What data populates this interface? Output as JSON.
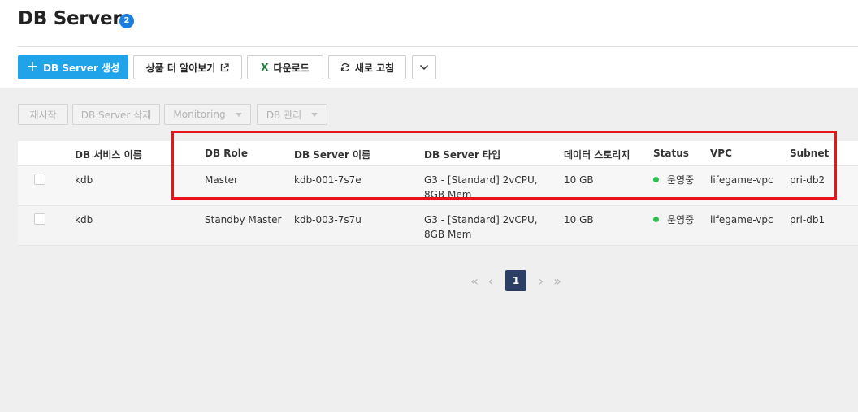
{
  "header": {
    "title": "DB Server",
    "count": "2"
  },
  "toolbar": {
    "create_label": "DB Server 생성",
    "learn_more_label": "상품 더 알아보기",
    "download_label": "다운로드",
    "refresh_label": "새로 고침"
  },
  "actions": {
    "restart_label": "재시작",
    "delete_label": "DB Server 삭제",
    "monitoring_label": "Monitoring",
    "db_manage_label": "DB 관리"
  },
  "table": {
    "columns": {
      "service_name": "DB 서비스 이름",
      "role": "DB Role",
      "server_name": "DB Server 이름",
      "server_type": "DB Server 타입",
      "storage": "데이터 스토리지",
      "status": "Status",
      "vpc": "VPC",
      "subnet": "Subnet"
    },
    "rows": [
      {
        "service_name": "kdb",
        "role": "Master",
        "server_name": "kdb-001-7s7e",
        "server_type": "G3 - [Standard] 2vCPU, 8GB Mem",
        "storage": "10 GB",
        "status": "운영중",
        "vpc": "lifegame-vpc",
        "subnet": "pri-db2"
      },
      {
        "service_name": "kdb",
        "role": "Standby Master",
        "server_name": "kdb-003-7s7u",
        "server_type": "G3 - [Standard] 2vCPU, 8GB Mem",
        "storage": "10 GB",
        "status": "운영중",
        "vpc": "lifegame-vpc",
        "subnet": "pri-db1"
      }
    ]
  },
  "pagination": {
    "current_page": "1"
  },
  "colors": {
    "primary": "#21a3ea",
    "badge": "#1a7fe0",
    "status_running": "#2bc24f",
    "page_active": "#2c3e66",
    "highlight": "#e8131b"
  },
  "icons": {
    "create": "plus-icon",
    "external": "external-link-icon",
    "download": "excel-icon",
    "refresh": "refresh-icon",
    "more": "chevron-down-icon"
  }
}
